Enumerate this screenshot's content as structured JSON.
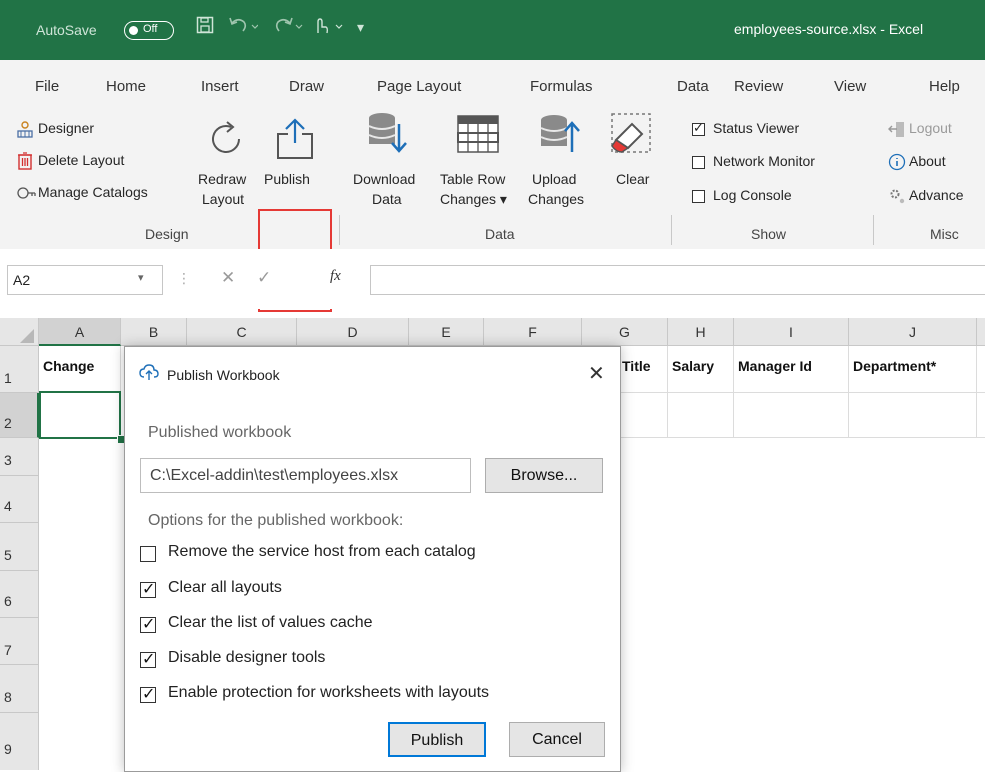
{
  "titlebar": {
    "autosave_label": "AutoSave",
    "autosave_state": "Off",
    "document_title": "employees-source.xlsx  -  Excel",
    "accent": "#217346"
  },
  "tabs": [
    "File",
    "Home",
    "Insert",
    "Draw",
    "Page Layout",
    "Formulas",
    "Data",
    "Review",
    "View",
    "Help"
  ],
  "ribbon": {
    "design": {
      "designer": "Designer",
      "delete_layout": "Delete Layout",
      "manage_catalogs": "Manage Catalogs",
      "redraw_l1": "Redraw",
      "redraw_l2": "Layout",
      "publish": "Publish",
      "group_label": "Design"
    },
    "data": {
      "download_l1": "Download",
      "download_l2": "Data",
      "tablerow_l1": "Table Row",
      "tablerow_l2": "Changes ▾",
      "upload_l1": "Upload",
      "upload_l2": "Changes",
      "clear": "Clear",
      "group_label": "Data"
    },
    "show": {
      "status_viewer": "Status Viewer",
      "status_viewer_checked": true,
      "network_monitor": "Network Monitor",
      "network_monitor_checked": false,
      "log_console": "Log Console",
      "log_console_checked": false,
      "group_label": "Show"
    },
    "misc": {
      "logout": "Logout",
      "about": "About",
      "advanced": "Advance",
      "group_label": "Misc"
    }
  },
  "formula_bar": {
    "name_box": "A2",
    "fx": "fx",
    "value": ""
  },
  "grid": {
    "columns": [
      "A",
      "B",
      "C",
      "D",
      "E",
      "F",
      "G",
      "H",
      "I",
      "J"
    ],
    "rows": [
      "1",
      "2",
      "3",
      "4",
      "5",
      "6",
      "7",
      "8",
      "9"
    ],
    "header_row": {
      "A": "Change",
      "G": "Title",
      "H": "Salary",
      "I": "Manager Id",
      "J": "Department*"
    }
  },
  "dialog": {
    "title": "Publish Workbook",
    "published_label": "Published workbook",
    "path": "C:\\Excel-addin\\test\\employees.xlsx",
    "browse": "Browse...",
    "options_label": "Options for the published workbook:",
    "options": [
      {
        "label": "Remove the service host from each catalog",
        "checked": false
      },
      {
        "label": "Clear all layouts",
        "checked": true
      },
      {
        "label": "Clear the list of values cache",
        "checked": true
      },
      {
        "label": "Disable designer tools",
        "checked": true
      },
      {
        "label": "Enable protection for worksheets with layouts",
        "checked": true
      }
    ],
    "publish_button": "Publish",
    "cancel_button": "Cancel"
  }
}
